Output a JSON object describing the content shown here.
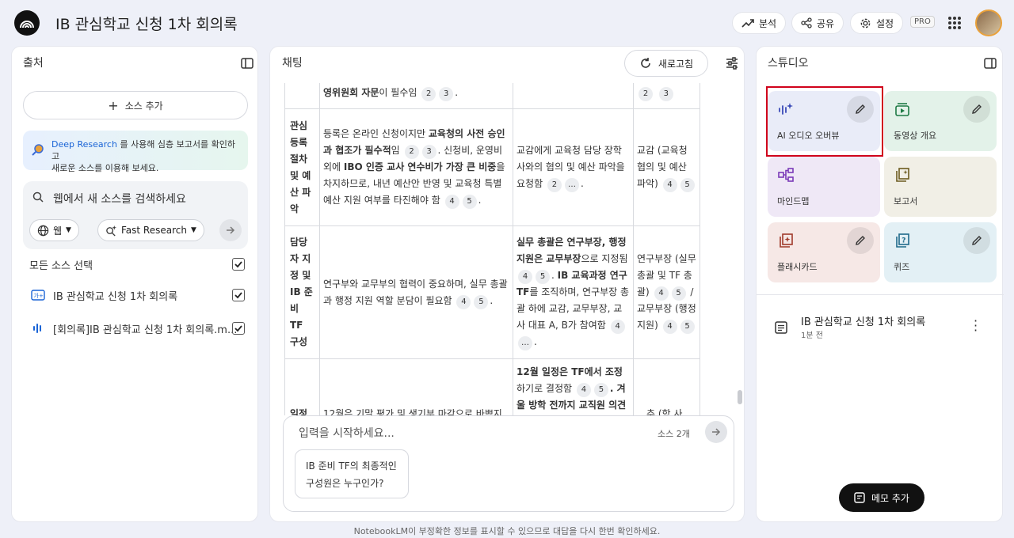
{
  "app": {
    "title": "IB 관심학교 신청 1차 회의록"
  },
  "header": {
    "analyze": "분석",
    "share": "공유",
    "settings": "설정",
    "pro": "PRO"
  },
  "sources": {
    "title": "출처",
    "add_label": "소스 추가",
    "deep_research": {
      "link": "Deep Research",
      "text_a": " 를 사용해 심층 보고서를 확인하고",
      "text_b": "새로운 소스를 이용해 보세요."
    },
    "search_placeholder": "웹에서 새 소스를 검색하세요",
    "web_chip": "웹",
    "research_chip": "Fast Research",
    "select_all": "모든 소스 선택",
    "items": [
      {
        "label": "IB 관심학교 신청 1차 회의록",
        "checked": true
      },
      {
        "label": "[회의록]IB 관심학교 신청 1차 회의록.m...",
        "checked": true
      }
    ]
  },
  "chat": {
    "title": "채팅",
    "refresh": "새로고침",
    "input_placeholder": "입력을 시작하세요...",
    "source_count": "소스 2개",
    "suggestion_a": "IB 준비 TF의 최종적인",
    "suggestion_b": "구성원은 누구인가?",
    "table": {
      "r0": {
        "c2_bold": "영위원회 자문",
        "c2_rest": "이 필수임",
        "c2_cites": [
          "2",
          "3"
        ],
        "c4_cites": [
          "2",
          "3"
        ]
      },
      "r1": {
        "c1": "관심 등록 절차 및 예산 파악",
        "c2_a": "등록은 온라인 신청이지만 ",
        "c2_b": "교육청의 사전 승인 과 협조가 필수적",
        "c2_c": "임",
        "c2_cites1": [
          "2",
          "3"
        ],
        "c2_d": ". 신청비, 운영비 외에 ",
        "c2_e": "IBO 인증 교사 연수비가 가장 큰 비중",
        "c2_f": "을 차지하므로, 내년 예산안 반영 및 교육청 특별 예산 지원 여부를 타진해야 함",
        "c2_cites2": [
          "4",
          "5"
        ],
        "c3": "교감에게 교육청 담당 장학사와의 협의 및 예산 파악을 요청함",
        "c3_cites": [
          "2",
          "…"
        ],
        "c4": "교감 (교육청 협의 및 예산 파악)",
        "c4_cites": [
          "4",
          "5"
        ]
      },
      "r2": {
        "c1": "담당자 지정 및 IB 준비 TF 구성",
        "c2": "연구부와 교무부의 협력이 중요하며, 실무 총괄과 행정 지원 역할 분담이 필요함",
        "c2_cites": [
          "4",
          "5"
        ],
        "c3_a": "실무 총괄은 연구부장, 행정 지원은 교무부장",
        "c3_b": "으로 지정됨",
        "c3_cites1": [
          "4",
          "5"
        ],
        "c3_c": "IB 교육과정 연구 TF",
        "c3_d": "를 조직하며, 연구부장 총괄 하에 교감, 교무부장, 교사 대표 A, B가 참여함",
        "c3_cites2": [
          "4",
          "…"
        ],
        "c4": "연구부장 (실무 총괄 및 TF 총괄)",
        "c4_cites1": [
          "4",
          "5"
        ],
        "c4_b": "/ 교무부장 (행정 지원)",
        "c4_cites2": [
          "4",
          "5"
        ]
      },
      "r3": {
        "c1": "일정",
        "c2": "12월은 기말 평가 및 생기부 마감으로 바쁘지",
        "c3_a": "12월 일정은 TF에서 조정",
        "c3_b": "하기로 결정함",
        "c3_cites": [
          "4",
          "5"
        ],
        "c3_c": ". 겨울 방학 전까지 교직원 의견 수",
        "c4": "…추 (학 사"
      }
    }
  },
  "studio": {
    "title": "스튜디오",
    "tiles": [
      {
        "label": "AI 오디오 오버뷰",
        "icon": "audio-sparkle-icon",
        "bg": "#e9ecf8"
      },
      {
        "label": "동영상 개요",
        "icon": "video-overview-icon",
        "bg": "#e3f2e9"
      },
      {
        "label": "마인드맵",
        "icon": "mindmap-icon",
        "bg": "#efe8f6"
      },
      {
        "label": "보고서",
        "icon": "report-icon",
        "bg": "#f1efe6"
      },
      {
        "label": "플래시카드",
        "icon": "flashcard-icon",
        "bg": "#f6e8e6"
      },
      {
        "label": "퀴즈",
        "icon": "quiz-icon",
        "bg": "#e3f0f5"
      }
    ],
    "note": {
      "title": "IB 관심학교 신청 1차 회의록",
      "time": "1분 전"
    },
    "memo_button": "메모 추가"
  },
  "footer": "NotebookLM이 부정확한 정보를 표시할 수 있으므로 대답을 다시 한번 확인하세요."
}
